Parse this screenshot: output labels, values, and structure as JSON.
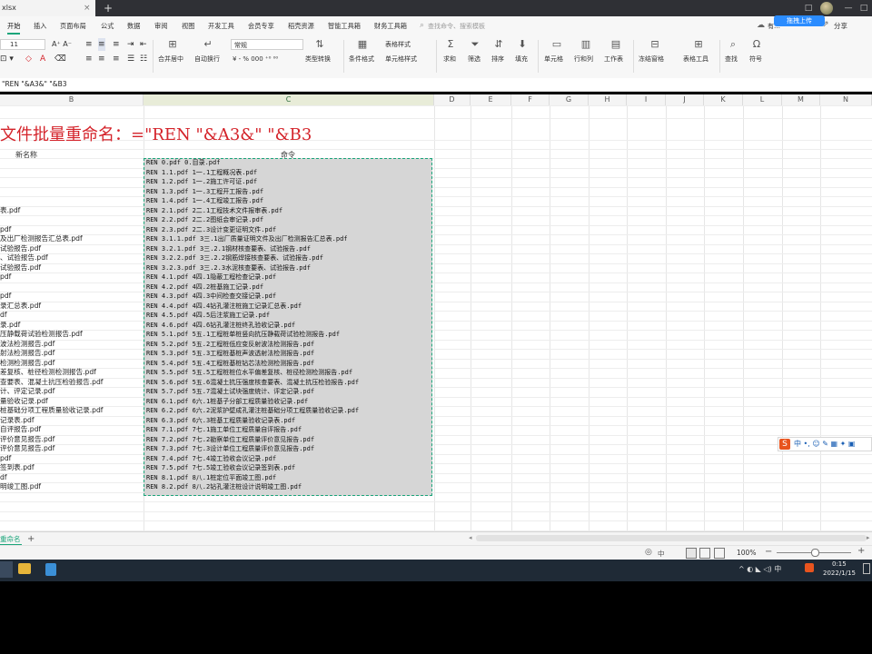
{
  "window": {
    "tab_title": "xlsx",
    "tab_close": "×",
    "new_tab": "+",
    "controls": [
      "□",
      "—",
      "□"
    ]
  },
  "menu": {
    "items": [
      "开始",
      "插入",
      "页面布局",
      "公式",
      "数据",
      "审阅",
      "视图",
      "开发工具",
      "会员专享",
      "稻壳资源",
      "智能工具箱",
      "财务工具箱"
    ],
    "search_placeholder": "查找命令、搜索模板",
    "upload_badge": "拖拽上传",
    "share": "分享",
    "extra": "有…"
  },
  "ribbon": {
    "font_size": "11",
    "number_format": "常规",
    "groups": [
      {
        "label": "合并居中"
      },
      {
        "label": "自动换行"
      },
      {
        "label": "类型转换"
      },
      {
        "label": "条件格式"
      },
      {
        "label": "表格样式"
      },
      {
        "label": "单元格样式"
      },
      {
        "label": "求和"
      },
      {
        "label": "筛选"
      },
      {
        "label": "排序"
      },
      {
        "label": "填充"
      },
      {
        "label": "单元格"
      },
      {
        "label": "行和列"
      },
      {
        "label": "工作表"
      },
      {
        "label": "冻结窗格"
      },
      {
        "label": "表格工具"
      },
      {
        "label": "查找"
      },
      {
        "label": "符号"
      }
    ],
    "format_symbols": "¥ - % 000 ⁺⁰ ⁰⁰"
  },
  "formula_bar": {
    "content": "\"REN \"&A3&\" \"&B3"
  },
  "columns": [
    "B",
    "C",
    "D",
    "E",
    "F",
    "G",
    "H",
    "I",
    "J",
    "K",
    "L",
    "M",
    "N"
  ],
  "sheet": {
    "title": "文件批量重命名：=\"REN \"&A3&\" \"&B3",
    "header_b": "新名称",
    "header_c": "命令",
    "col_b": [
      "",
      "",
      "",
      "",
      "",
      "表.pdf",
      "",
      "pdf",
      "及出厂检测报告汇总表.pdf",
      "试验报告.pdf",
      "、试验报告.pdf",
      "试验报告.pdf",
      "pdf",
      "",
      "pdf",
      "录汇总表.pdf",
      "df",
      "录.pdf",
      "压静载荷试验检测报告.pdf",
      "波法检测报告.pdf",
      "射法检测报告.pdf",
      "检测检测报告.pdf",
      "差复核、桩径检测检测报告.pdf",
      "查要表、混凝土抗压检验报告.pdf",
      "计、评定记录.pdf",
      "量验收记录.pdf",
      "桩基础分项工程质量验收记录.pdf",
      "记录表.pdf",
      "自评报告.pdf",
      "评价意见报告.pdf",
      "评价意见报告.pdf",
      "pdf",
      "签到表.pdf",
      "df",
      "明竣工图.pdf"
    ],
    "col_c": [
      "REN 0.pdf 0.目录.pdf",
      "REN 1.1.pdf 1一.1工程概况表.pdf",
      "REN 1.2.pdf 1一.2施工许可证.pdf",
      "REN 1.3.pdf 1一.3工程开工报告.pdf",
      "REN 1.4.pdf 1一.4工程竣工报告.pdf",
      "REN 2.1.pdf 2二.1工程技术文件报审表.pdf",
      "REN 2.2.pdf 2二.2图纸会审记录.pdf",
      "REN 2.3.pdf 2二.3设计变更证明文件.pdf",
      "REN 3.1.1.pdf 3三.1出厂质量证明文件及出厂检测报告汇总表.pdf",
      "REN 3.2.1.pdf 3三.2.1钢材核查要表、试验报告.pdf",
      "REN 3.2.2.pdf 3三.2.2钢筋焊接核查要表、试验报告.pdf",
      "REN 3.2.3.pdf 3三.2.3水泥核查要表、试验报告.pdf",
      "REN 4.1.pdf 4四.1隐蔽工程检查记录.pdf",
      "REN 4.2.pdf 4四.2桩基施工记录.pdf",
      "REN 4.3.pdf 4四.3中间检查交接记录.pdf",
      "REN 4.4.pdf 4四.4钻孔灌注桩施工记录汇总表.pdf",
      "REN 4.5.pdf 4四.5后注浆施工记录.pdf",
      "REN 4.6.pdf 4四.6钻孔灌注桩终孔验收记录.pdf",
      "REN 5.1.pdf 5五.1工程桩单桩竖向抗压静载荷试验检测报告.pdf",
      "REN 5.2.pdf 5五.2工程桩低应变反射波法检测报告.pdf",
      "REN 5.3.pdf 5五.3工程桩基桩声波透射法检测报告.pdf",
      "REN 5.4.pdf 5五.4工程桩基桩钻芯法检测检测报告.pdf",
      "REN 5.5.pdf 5五.5工程桩桩位水平偏差复核、桩径检测检测报告.pdf",
      "REN 5.6.pdf 5五.6混凝土抗压强度核查要表、混凝土抗压检验报告.pdf",
      "REN 5.7.pdf 5五.7混凝土试块强度统计、评定记录.pdf",
      "REN 6.1.pdf 6六.1桩基子分部工程质量验收记录.pdf",
      "REN 6.2.pdf 6六.2泥浆护壁成孔灌注桩基础分项工程质量验收记录.pdf",
      "REN 6.3.pdf 6六.3桩基工程质量验收记录表.pdf",
      "REN 7.1.pdf 7七.1施工单位工程质量自评报告.pdf",
      "REN 7.2.pdf 7七.2勘察单位工程质量评价意见报告.pdf",
      "REN 7.3.pdf 7七.3设计单位工程质量评价意见报告.pdf",
      "REN 7.4.pdf 7七.4竣工验收会议记录.pdf",
      "REN 7.5.pdf 7七.5竣工验收会议记录签到表.pdf",
      "REN 8.1.pdf 8八.1桩定位平面竣工图.pdf",
      "REN 8.2.pdf 8八.2钻孔灌注桩设计说明竣工图.pdf"
    ]
  },
  "sheet_tabs": {
    "active": "重命名",
    "add": "+"
  },
  "statusbar": {
    "zoom": "100%",
    "ime": "中",
    "minus": "−",
    "plus": "+"
  },
  "ime_toolbar": {
    "logo": "S",
    "items": "中 •, ☺ ✎ ▦ ✦ ▣"
  },
  "taskbar": {
    "time": "0:15",
    "date": "2022/1/15",
    "tray": "^ ◐ ◣ ◁) 中"
  },
  "colors": {
    "accent": "#1aa57a",
    "title_red": "#d4232a",
    "selection_fill": "#d6d6d6",
    "upload_blue": "#2b8cff"
  }
}
